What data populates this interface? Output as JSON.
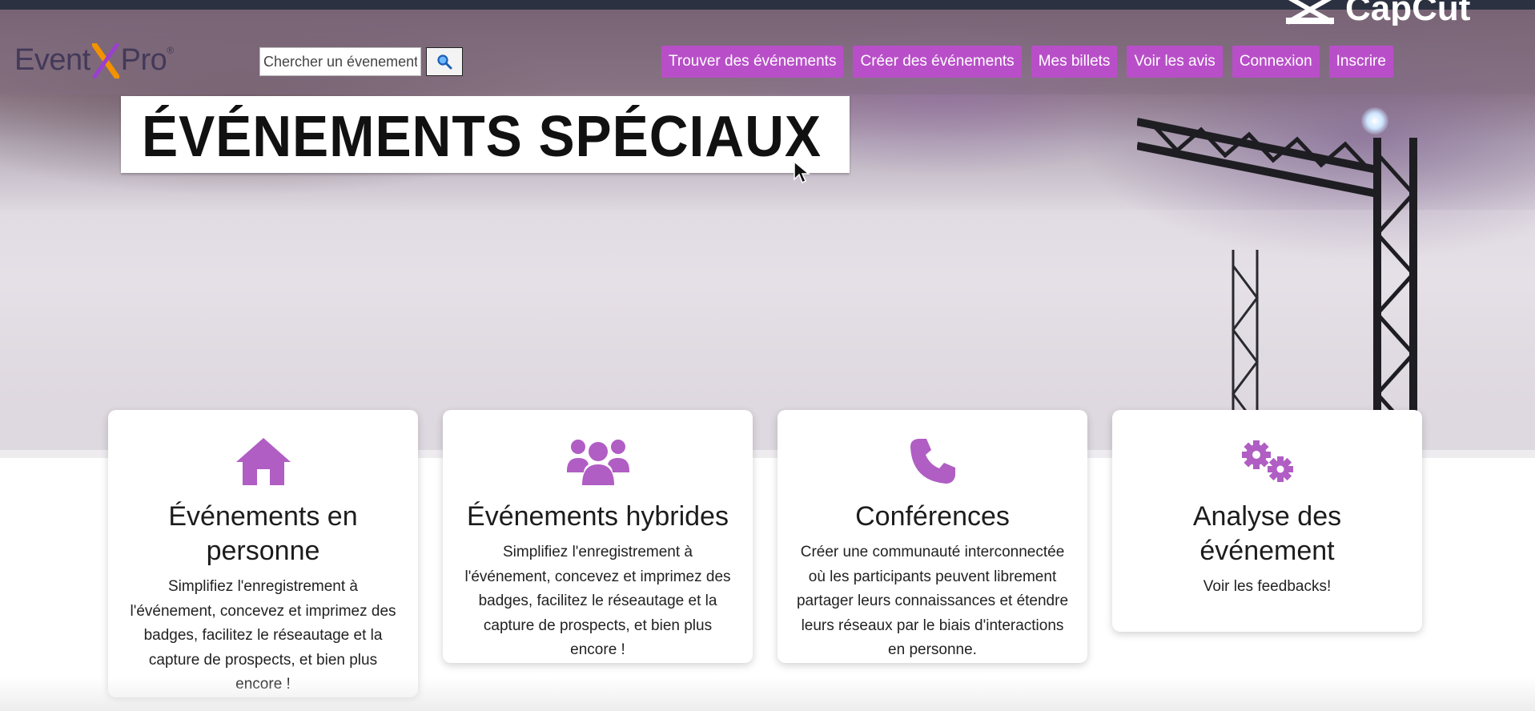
{
  "header": {
    "logo": {
      "part1": "Event",
      "part2": "Pro",
      "sup": "®"
    },
    "search": {
      "placeholder": "Chercher un évenement",
      "button_icon": "search-icon"
    },
    "nav": [
      "Trouver des événements",
      "Créer des événements",
      "Mes billets",
      "Voir les avis",
      "Connexion",
      "Inscrire"
    ],
    "watermark": "CapCut"
  },
  "hero": {
    "banner_text": "ÉVÉNEMENTS SPÉCIAUX"
  },
  "cards": [
    {
      "icon": "home-icon",
      "title": "Événements en personne",
      "text": "Simplifiez l'enregistrement à l'événement, concevez et imprimez des badges, facilitez le réseautage et la capture de prospects, et bien plus encore !"
    },
    {
      "icon": "users-icon",
      "title": "Événements hybrides",
      "text": "Simplifiez l'enregistrement à l'événement, concevez et imprimez des badges, facilitez le réseautage et la capture de prospects, et bien plus encore !"
    },
    {
      "icon": "phone-icon",
      "title": "Conférences",
      "text": "Créer une communauté interconnectée où les participants peuvent librement partager leurs connaissances et étendre leurs réseaux par le biais d'interactions en personne."
    },
    {
      "icon": "gears-icon",
      "title": "Analyse des événement",
      "text": "Voir les feedbacks!"
    }
  ],
  "colors": {
    "accent": "#b84fc8",
    "icon": "#b05ec4",
    "logo_x_orange": "#f39200",
    "logo_x_purple": "#9b3fd1"
  }
}
